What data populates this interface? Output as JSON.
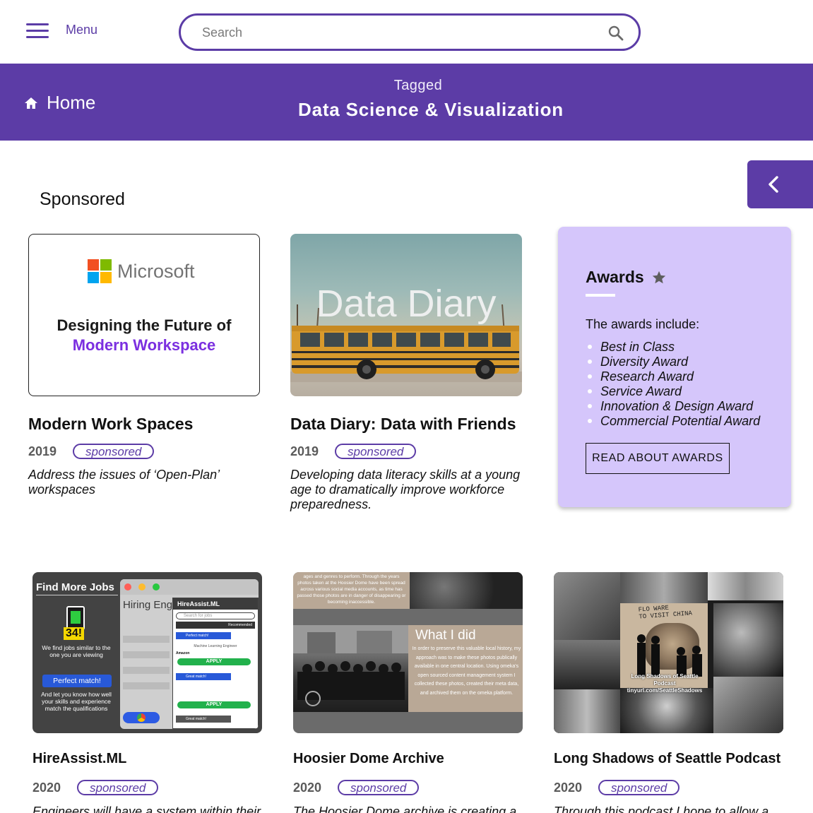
{
  "header": {
    "menu_label": "Menu",
    "search_placeholder": "Search"
  },
  "banner": {
    "home_label": "Home",
    "tagged_label": "Tagged",
    "tag_title": "Data Science & Visualization"
  },
  "section": {
    "title": "Sponsored"
  },
  "cards": [
    {
      "title": "Modern Work Spaces",
      "year": "2019",
      "badge": "sponsored",
      "description": "Address the issues of ‘Open-Plan’ workspaces",
      "thumb": {
        "brand": "Microsoft",
        "line1": "Designing the Future of",
        "line2": "Modern Workspace"
      }
    },
    {
      "title": "Data Diary: Data with Friends",
      "year": "2019",
      "badge": "sponsored",
      "description": "Developing data literacy skills at a young age to dramatically improve workforce preparedness.",
      "thumb": {
        "overlay": "Data Diary"
      }
    },
    {
      "title": "HireAssist.ML",
      "year": "2020",
      "badge": "sponsored",
      "description": "Engineers will have a system within their",
      "thumb": {
        "find": "Find More Jobs",
        "count": "34!",
        "similar": "We find jobs similar to the one you are viewing",
        "perfect": "Perfect match!",
        "know": "And let you know how well your skills and experience match the qualifications",
        "hiring": "Hiring Engineers",
        "panel_title": "HireAssist.ML",
        "search_jobs": "Search for jobs",
        "recommended": "Recommended",
        "match1": "Perfect match!",
        "job": "Machine Learning Engineer",
        "company": "Amazon",
        "location": "Seattle, WA",
        "apply": "APPLY",
        "match2": "Great match!",
        "match3": "Great match!"
      }
    },
    {
      "title": "Hoosier Dome Archive",
      "year": "2020",
      "badge": "sponsored",
      "description": "The Hoosier Dome archive is creating a",
      "thumb": {
        "top_text": "ages and genres to perform. Through the years photos taken at the Hoosier Dome have been spread across various social media accounts, as time has passed those photos are in danger of disappearing or becoming inaccessible.",
        "what_title": "What I did",
        "what_body": "In order to preserve this valuable local history, my approach was to make these photos publically available in one central location. Using omeka's open sourced content management system I collected these photos, created their meta data, and archived them on the omeka platform."
      }
    },
    {
      "title": "Long Shadows of Seattle Podcast",
      "year": "2020",
      "badge": "sponsored",
      "description": "Through this podcast I hope to allow a",
      "thumb": {
        "flo": "FLO WARE\nTO VISIT CHINA",
        "caption": "Long Shadows of Seattle Podcast",
        "url": "tinyurl.com/SeattleShadows"
      }
    }
  ],
  "awards": {
    "title": "Awards",
    "intro": "The awards include:",
    "items": [
      "Best in Class",
      "Diversity Award",
      "Research Award",
      "Service Award",
      "Innovation & Design Award",
      "Commercial Potential Award"
    ],
    "button_label": "READ ABOUT AWARDS"
  },
  "icons": {
    "menu": "hamburger-menu-icon",
    "search": "search-icon",
    "home": "home-icon",
    "collapse": "chevron-left-icon",
    "awards": "star-icon"
  },
  "colors": {
    "brand_purple": "#5c3ca6",
    "awards_bg": "#d5c6fb"
  }
}
